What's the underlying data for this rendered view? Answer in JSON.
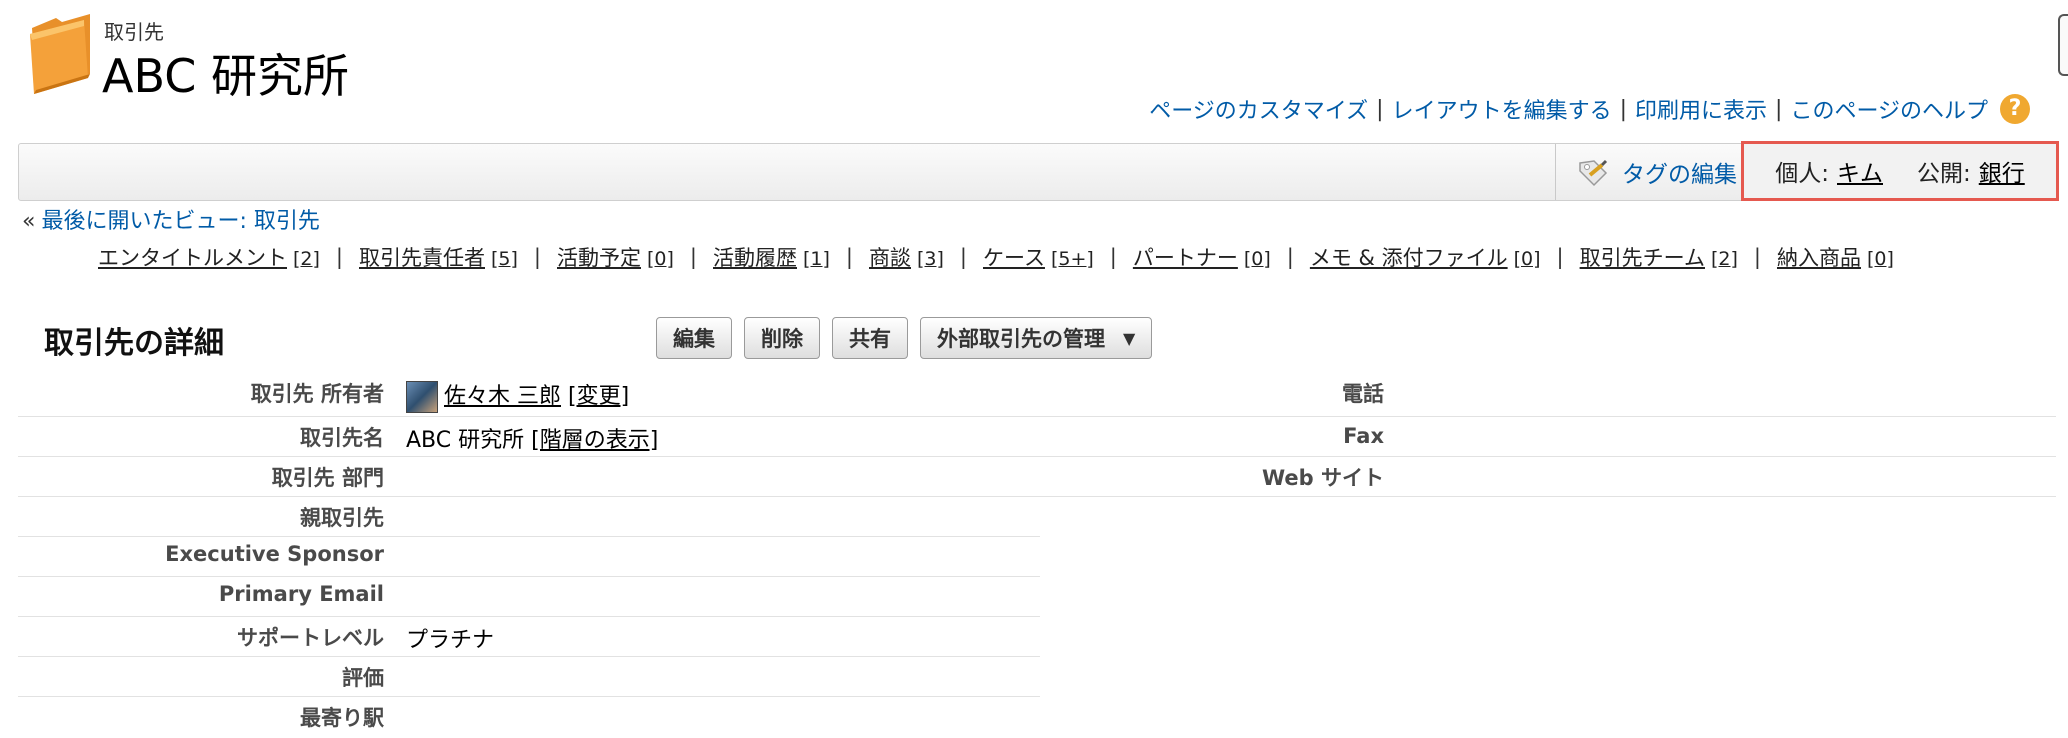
{
  "header": {
    "entity_type": "取引先",
    "title": "ABC 研究所"
  },
  "top_links": [
    "ページのカスタマイズ",
    "レイアウトを編集する",
    "印刷用に表示",
    "このページのヘルプ"
  ],
  "help_icon_glyph": "?",
  "tags": {
    "edit_label": "タグの編集",
    "personal_label": "個人:",
    "personal_value": "キム",
    "public_label": "公開:",
    "public_value": "銀行"
  },
  "back": {
    "chevron": "«",
    "label": "最後に開いたビュー: 取引先"
  },
  "related_lists": [
    {
      "label": "エンタイトルメント",
      "count": "[2]"
    },
    {
      "label": "取引先責任者",
      "count": "[5]"
    },
    {
      "label": "活動予定",
      "count": "[0]"
    },
    {
      "label": "活動履歴",
      "count": "[1]"
    },
    {
      "label": "商談",
      "count": "[3]"
    },
    {
      "label": "ケース",
      "count": "[5+]"
    },
    {
      "label": "パートナー",
      "count": "[0]"
    },
    {
      "label": "メモ & 添付ファイル",
      "count": "[0]"
    },
    {
      "label": "取引先チーム",
      "count": "[2]"
    },
    {
      "label": "納入商品",
      "count": "[0]"
    }
  ],
  "detail": {
    "title": "取引先の詳細",
    "buttons": {
      "edit": "編集",
      "delete": "削除",
      "share": "共有",
      "external": "外部取引先の管理",
      "caret": "▼"
    },
    "owner": {
      "label": "取引先 所有者",
      "name": "佐々木 三郎",
      "change": "[変更]"
    },
    "account_name": {
      "label": "取引先名",
      "value": "ABC 研究所",
      "hierarchy": "[階層の表示]"
    },
    "division": {
      "label": "取引先 部門"
    },
    "parent": {
      "label": "親取引先"
    },
    "sponsor": {
      "label": "Executive Sponsor"
    },
    "email": {
      "label": "Primary Email"
    },
    "support": {
      "label": "サポートレベル",
      "value": "プラチナ"
    },
    "rating": {
      "label": "評価"
    },
    "station": {
      "label": "最寄り駅"
    },
    "phone": {
      "label": "電話"
    },
    "fax": {
      "label": "Fax"
    },
    "website": {
      "label": "Web サイト"
    }
  },
  "colors": {
    "link": "#015ba7",
    "highlight_border": "#e5594f",
    "help_icon": "#f0a830",
    "folder": "#f4a13a"
  }
}
